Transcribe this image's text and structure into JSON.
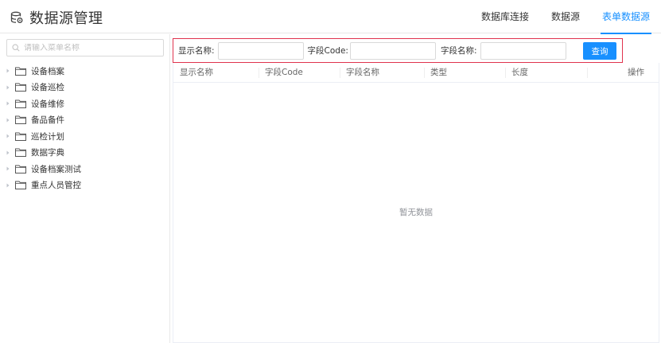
{
  "app": {
    "title": "数据源管理",
    "icon": "database-icon"
  },
  "nav": {
    "items": [
      {
        "label": "数据库连接",
        "active": false
      },
      {
        "label": "数据源",
        "active": false
      },
      {
        "label": "表单数据源",
        "active": true
      }
    ]
  },
  "sidebar": {
    "search_placeholder": "请输入菜单名称",
    "items": [
      {
        "label": "设备档案"
      },
      {
        "label": "设备巡检"
      },
      {
        "label": "设备维修"
      },
      {
        "label": "备品备件"
      },
      {
        "label": "巡检计划"
      },
      {
        "label": "数据字典"
      },
      {
        "label": "设备档案测试"
      },
      {
        "label": "重点人员管控"
      }
    ]
  },
  "filter": {
    "display_name_label": "显示名称:",
    "display_name_value": "",
    "field_code_label": "字段Code:",
    "field_code_value": "",
    "field_name_label": "字段名称:",
    "field_name_value": "",
    "query_label": "查询"
  },
  "table": {
    "columns": [
      "显示名称",
      "字段Code",
      "字段名称",
      "类型",
      "长度",
      "操作"
    ],
    "rows": [],
    "empty_text": "暂无数据"
  },
  "colors": {
    "accent": "#1890ff",
    "highlight_border": "#e0334e",
    "text": "#333333",
    "muted": "#909399"
  }
}
